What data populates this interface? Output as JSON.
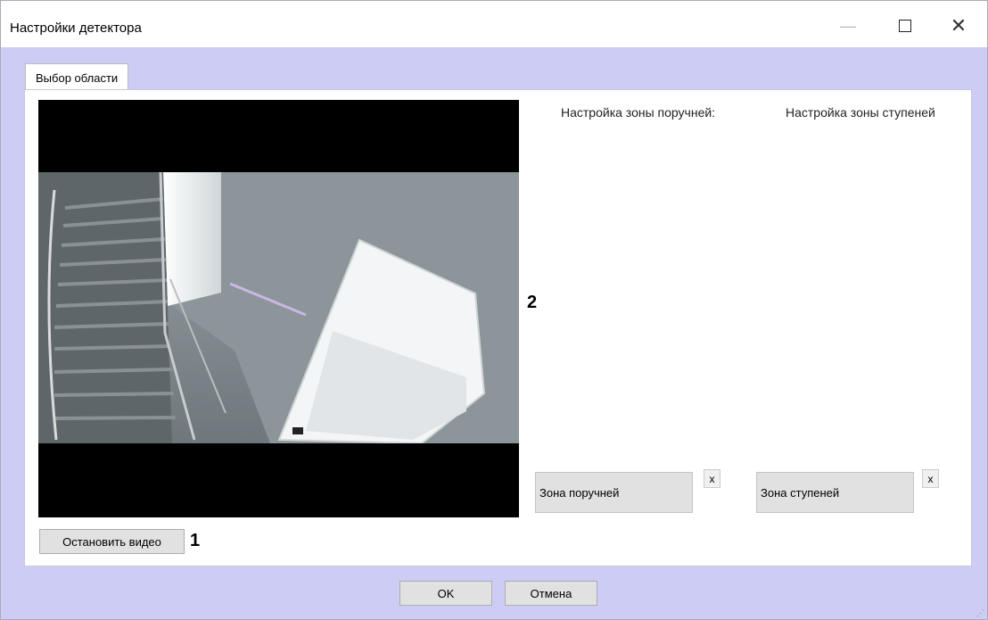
{
  "window": {
    "title": "Настройки детектора",
    "controls": {
      "minimize": "—",
      "maximize": "",
      "close": "✕"
    }
  },
  "tab": {
    "label": "Выбор области"
  },
  "video": {
    "stop_label": "Остановить видео",
    "marker": "1"
  },
  "area_marker": "2",
  "zones": {
    "rail": {
      "header": "Настройка зоны поручней:",
      "button": "Зона поручней",
      "remove": "x"
    },
    "steps": {
      "header": "Настройка зоны ступеней",
      "button": "Зона ступеней",
      "remove": "x"
    }
  },
  "footer": {
    "ok_label": "OK",
    "cancel_label": "Отмена"
  }
}
